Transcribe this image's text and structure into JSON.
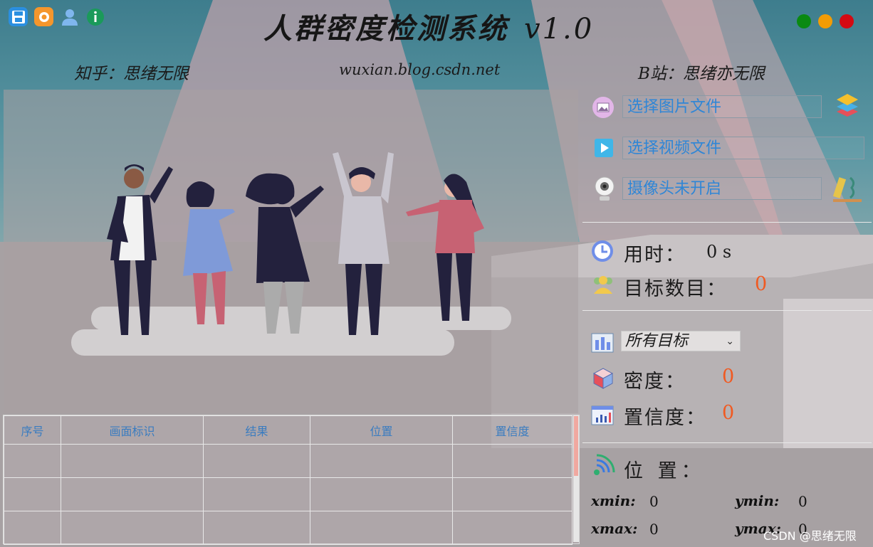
{
  "app": {
    "title": "人群密度检测系统",
    "version": "v1.0"
  },
  "toolbar": {
    "icons": [
      "save-icon",
      "settings-icon",
      "user-icon",
      "info-icon"
    ]
  },
  "window_controls": {
    "colors": [
      "#0a8a12",
      "#f39c05",
      "#d40a12"
    ]
  },
  "subtitle": {
    "zhihu": "知乎：思绪无限",
    "site": "wuxian.blog.csdn.net",
    "bilibili": "B站：思绪亦无限"
  },
  "table": {
    "headers": [
      "序号",
      "画面标识",
      "结果",
      "位置",
      "置信度"
    ],
    "rows": [
      [
        "",
        "",
        "",
        "",
        ""
      ],
      [
        "",
        "",
        "",
        "",
        ""
      ],
      [
        "",
        "",
        "",
        "",
        ""
      ]
    ]
  },
  "panel": {
    "image_button": "选择图片文件",
    "video_button": "选择视频文件",
    "camera_button": "摄像头未开启",
    "time_label": "用时：",
    "time_value": "0 s",
    "count_label": "目标数目：",
    "count_value": "0",
    "target_select": "所有目标",
    "density_label": "密度：",
    "density_value": "0",
    "confidence_label": "置信度：",
    "confidence_value": "0",
    "position_label": "位 置：",
    "xmin_label": "xmin:",
    "xmin_value": "0",
    "ymin_label": "ymin:",
    "ymin_value": "0",
    "xmax_label": "xmax:",
    "xmax_value": "0",
    "ymax_label": "ymax:",
    "ymax_value": "0"
  },
  "watermark": "CSDN @思绪无限"
}
